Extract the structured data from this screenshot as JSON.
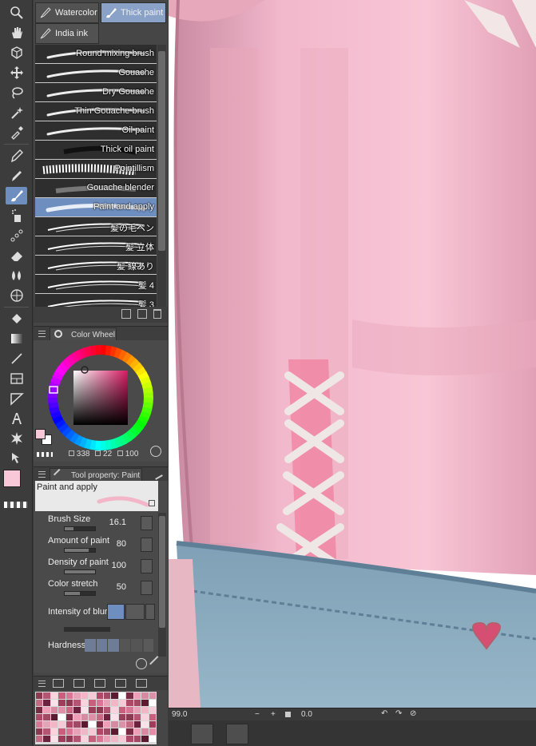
{
  "brush_subtools": {
    "watercolor": "Watercolor",
    "thick_paint": "Thick paint",
    "india_ink": "India ink"
  },
  "brushes": [
    {
      "label": "Round mixing brush",
      "style": "round"
    },
    {
      "label": "Gouache",
      "style": "gouache"
    },
    {
      "label": "Dry Gouache",
      "style": "dry"
    },
    {
      "label": "Thin Gouache brush",
      "style": "thin"
    },
    {
      "label": "Oil paint",
      "style": "oil"
    },
    {
      "label": "Thick oil paint",
      "style": "thick"
    },
    {
      "label": "Pointillism",
      "style": "point"
    },
    {
      "label": "Gouache blender",
      "style": "blender"
    },
    {
      "label": "Paint and apply",
      "style": "apply",
      "selected": true
    },
    {
      "label": "髪の毛ペン",
      "style": "hair"
    },
    {
      "label": "髪 立体",
      "style": "hair"
    },
    {
      "label": "髪 線あり",
      "style": "hair"
    },
    {
      "label": "髪 4",
      "style": "hair"
    },
    {
      "label": "髪 3",
      "style": "hair"
    }
  ],
  "color_wheel": {
    "tab_label": "Color Wheel",
    "hue_readout": "338",
    "sat_readout": "22",
    "val_readout": "100",
    "main_color": "#f9c8d8",
    "sub_color": "#ffffff"
  },
  "tool_property": {
    "tab_label": "Tool property: Paint",
    "brush_name": "Paint and apply",
    "rows": [
      {
        "label": "Brush Size",
        "value": "16.1",
        "level": 0.3
      },
      {
        "label": "Amount of paint",
        "value": "80",
        "level": 0.8
      },
      {
        "label": "Density of paint",
        "value": "100",
        "level": 1.0
      },
      {
        "label": "Color stretch",
        "value": "50",
        "level": 0.5
      }
    ],
    "blur_label": "Intensity of blur",
    "hardness_label": "Hardness"
  },
  "status": {
    "zoom": "99.0",
    "rotation": "0.0"
  },
  "palette_colors": [
    "#8c3a52",
    "#c85f7c",
    "#f3b6c7",
    "#a34865",
    "#7a2a43",
    "#e08fa8",
    "#fbe1e9",
    "#b65474",
    "#d97695",
    "#f6c9d6",
    "#5c1a30",
    "#ee9fb7",
    "#c76b85",
    "#9e3e5b",
    "#fad3df",
    "#e6a2b6",
    "#b04868",
    "#ffffff",
    "#d78aa2",
    "#6d2340"
  ],
  "accent": "#6e8ebf"
}
